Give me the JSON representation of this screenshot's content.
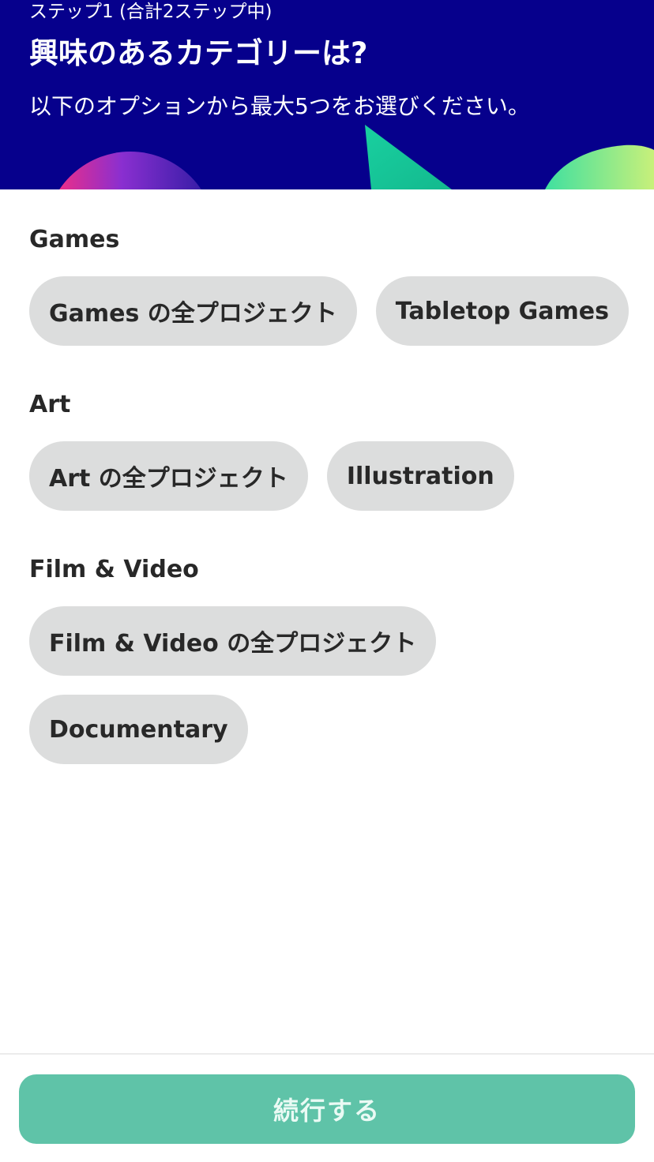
{
  "header": {
    "step": "ステップ1 (合計2ステップ中)",
    "title": "興味のあるカテゴリーは?",
    "subtitle": "以下のオプションから最大5つをお選びください。",
    "background": "#06008c"
  },
  "sections": [
    {
      "title": "Games",
      "chips": [
        "Games の全プロジェクト",
        "Tabletop Games"
      ]
    },
    {
      "title": "Art",
      "chips": [
        "Art の全プロジェクト",
        "Illustration"
      ]
    },
    {
      "title": "Film & Video",
      "chips": [
        "Film & Video の全プロジェクト",
        "Documentary"
      ]
    }
  ],
  "footer": {
    "continue_label": "続行する",
    "button_color": "#5fc3a8"
  },
  "colors": {
    "chip_background": "#dcdddd",
    "text": "#282828"
  }
}
